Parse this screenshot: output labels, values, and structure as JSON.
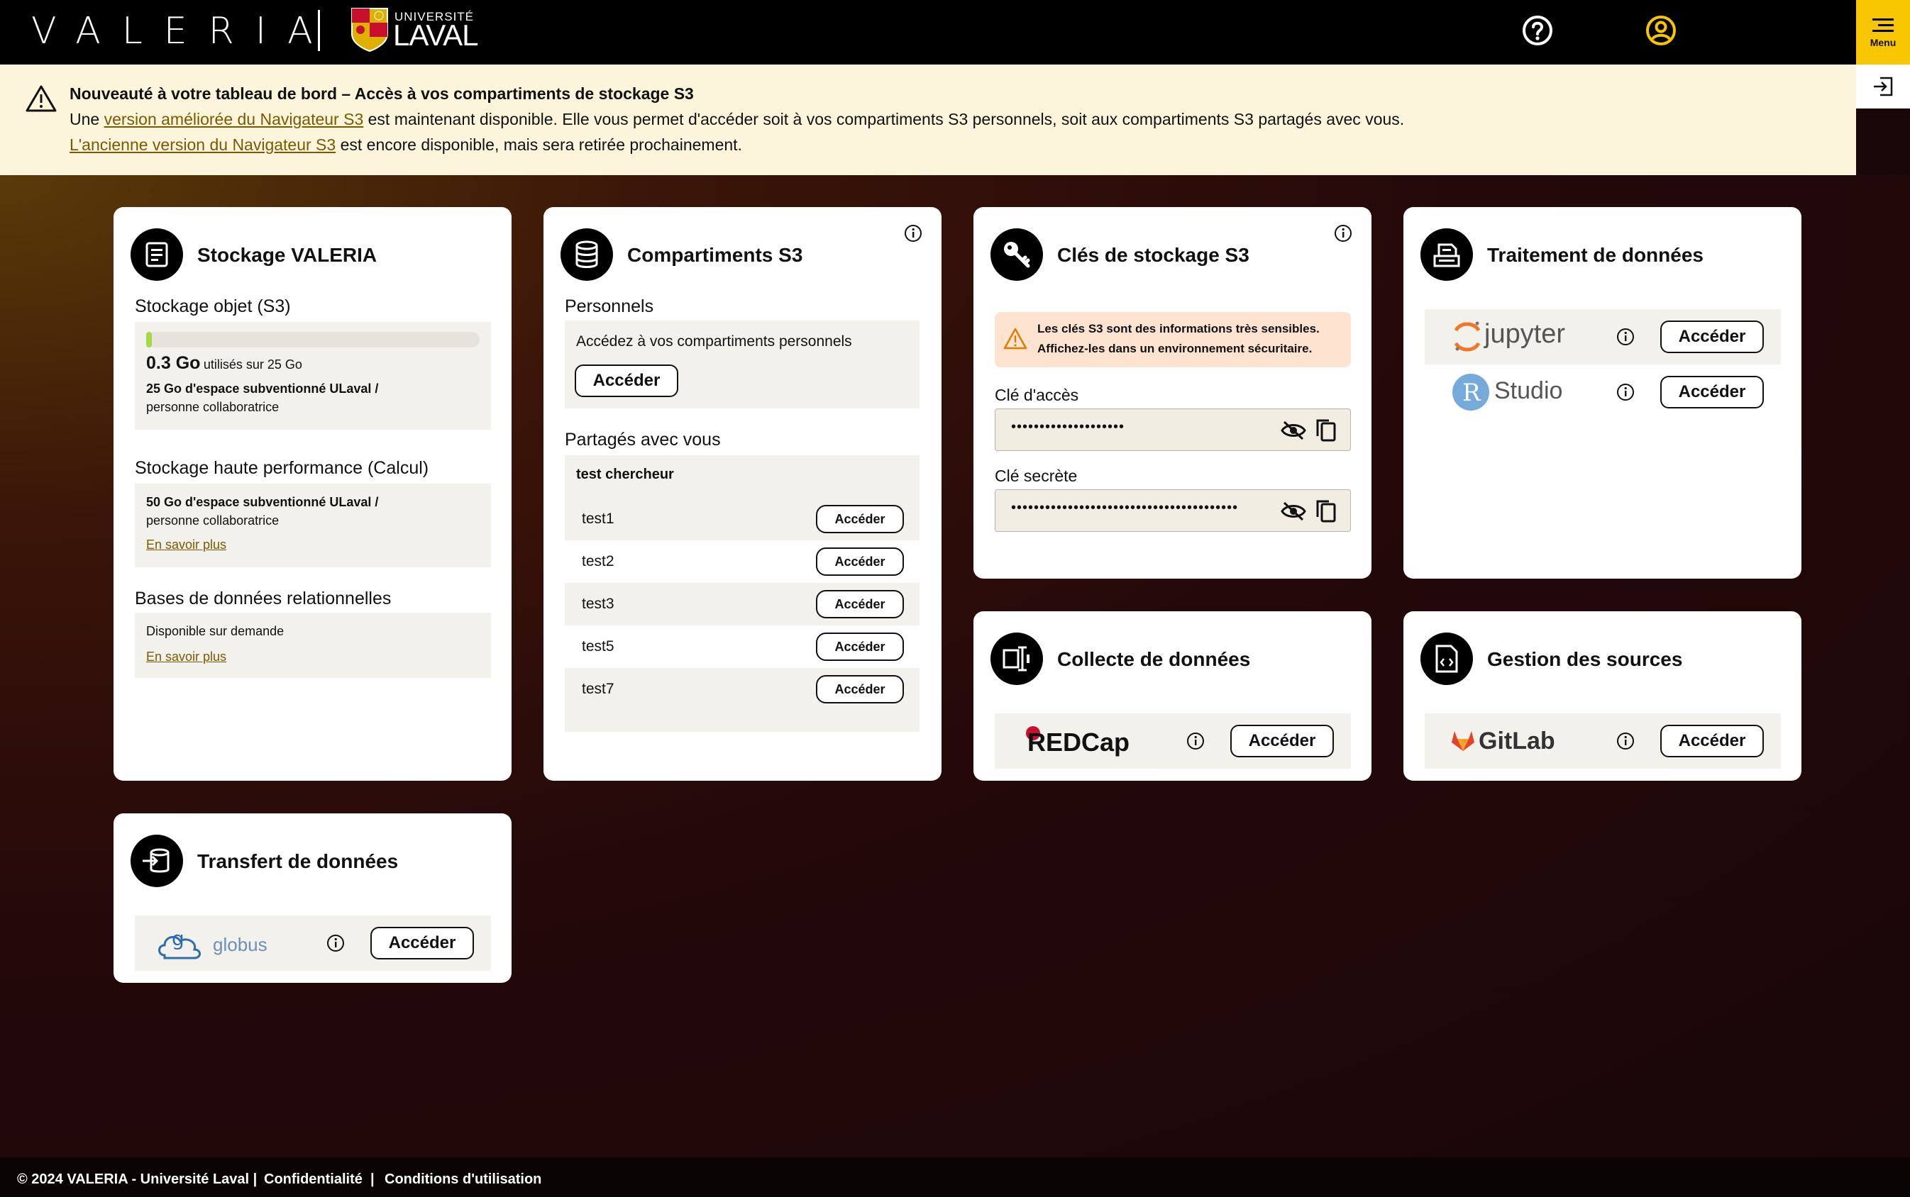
{
  "header": {
    "brand": "VALERIA",
    "university_small": "UNIVERSITÉ",
    "university_main": "LAVAL",
    "menu_label": "Menu"
  },
  "banner": {
    "title": "Nouveauté à votre tableau de bord – Accès à vos compartiments de stockage S3",
    "line1_prefix": "Une ",
    "line1_link": "version améliorée du Navigateur S3",
    "line1_suffix": " est maintenant disponible. Elle vous permet d'accéder soit à vos compartiments S3 personnels, soit aux compartiments S3 partagés avec vous.",
    "line2_link": "L'ancienne version du Navigateur S3",
    "line2_suffix": " est encore disponible, mais sera retirée prochainement."
  },
  "storage": {
    "title": "Stockage VALERIA",
    "s3_title": "Stockage objet (S3)",
    "used_value": "0.3 Go",
    "used_suffix": "utilisés sur 25 Go",
    "used_fraction": 0.012,
    "s3_quota": "25 Go d'espace subventionné ULaval /",
    "s3_quota_sub": "personne collaboratrice",
    "hpc_title": "Stockage haute performance (Calcul)",
    "hpc_quota": "50 Go d'espace subventionné ULaval /",
    "hpc_quota_sub": "personne collaboratrice",
    "hpc_link": "En savoir plus",
    "db_title": "Bases de données relationnelles",
    "db_text": "Disponible sur demande",
    "db_link": "En savoir plus"
  },
  "buckets": {
    "title": "Compartiments S3",
    "personal_title": "Personnels",
    "personal_text": "Accédez à vos compartiments personnels",
    "personal_button": "Accéder",
    "shared_title": "Partagés avec vous",
    "shared_owner": "test chercheur",
    "shared_items": [
      {
        "name": "test1",
        "button": "Accéder"
      },
      {
        "name": "test2",
        "button": "Accéder"
      },
      {
        "name": "test3",
        "button": "Accéder"
      },
      {
        "name": "test5",
        "button": "Accéder"
      },
      {
        "name": "test7",
        "button": "Accéder"
      }
    ]
  },
  "keys": {
    "title": "Clés de stockage S3",
    "warning_line1": "Les clés S3 sont des informations très sensibles.",
    "warning_line2": "Affichez-les dans un environnement sécuritaire.",
    "access_label": "Clé d'accès",
    "access_value": "••••••••••••••••••••",
    "secret_label": "Clé secrète",
    "secret_value": "••••••••••••••••••••••••••••••••••••••••"
  },
  "processing": {
    "title": "Traitement de données",
    "services": [
      {
        "name": "jupyter",
        "button": "Accéder"
      },
      {
        "name": "Studio",
        "button": "Accéder"
      }
    ]
  },
  "collect": {
    "title": "Collecte de données",
    "service": "REDCap",
    "button": "Accéder"
  },
  "sources": {
    "title": "Gestion des sources",
    "service": "GitLab",
    "button": "Accéder"
  },
  "transfer": {
    "title": "Transfert de données",
    "service": "globus",
    "button": "Accéder"
  },
  "footer": {
    "copyright": "© 2024 VALERIA - Université Laval |",
    "privacy": "Confidentialité",
    "sep": "|",
    "terms": "Conditions d'utilisation"
  },
  "colors": {
    "accent": "#f7c600",
    "banner_bg": "#fcf5dc",
    "link": "#7a5a00",
    "warning_bg": "#fde3d0"
  }
}
